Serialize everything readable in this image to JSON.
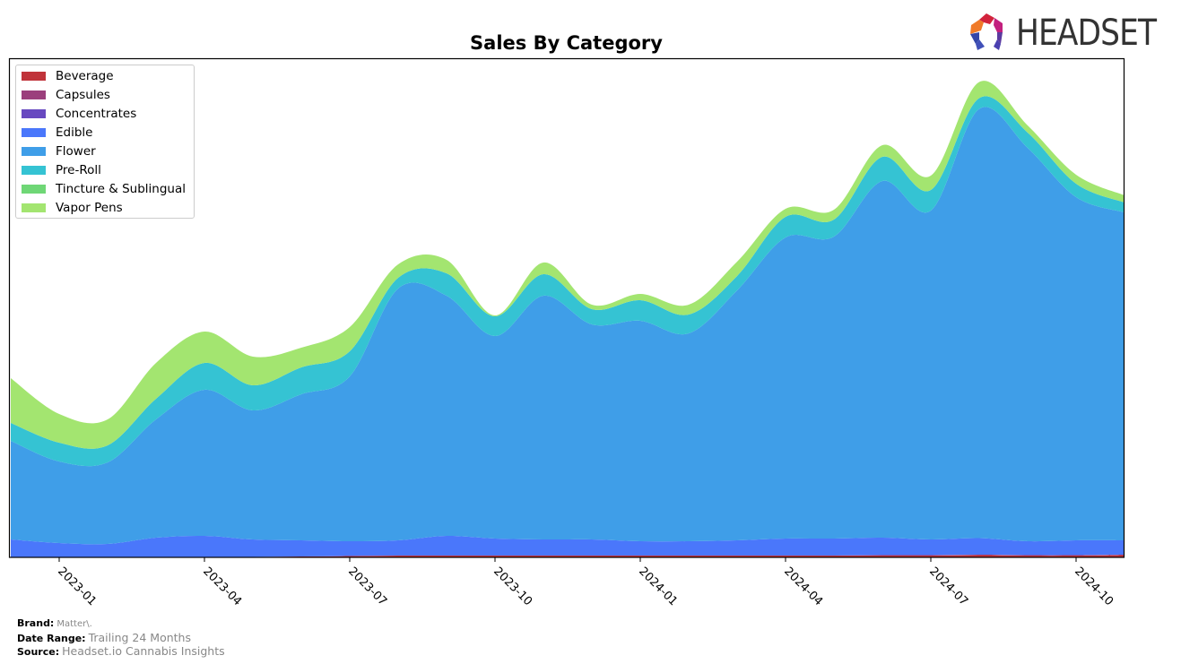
{
  "header": {
    "title": "Sales By Category",
    "logo_text": "HEADSET"
  },
  "footer": {
    "brand_label": "Brand:",
    "brand_value": "Matter\\.",
    "date_range_label": "Date Range:",
    "date_range_value": "Trailing 24 Months",
    "source_label": "Source:",
    "source_value": "Headset.io Cannabis Insights"
  },
  "chart_data": {
    "type": "area",
    "stacked": true,
    "smooth": true,
    "title": "Sales By Category",
    "xlabel": "",
    "ylabel": "",
    "y_units": "relative sales (unlabeled axis)",
    "grid": false,
    "legend_position": "top-left",
    "x": [
      "2022-12",
      "2023-01",
      "2023-02",
      "2023-03",
      "2023-04",
      "2023-05",
      "2023-06",
      "2023-07",
      "2023-08",
      "2023-09",
      "2023-10",
      "2023-11",
      "2023-12",
      "2024-01",
      "2024-02",
      "2024-03",
      "2024-04",
      "2024-05",
      "2024-06",
      "2024-07",
      "2024-08",
      "2024-09",
      "2024-10",
      "2024-11"
    ],
    "x_tick_labels": [
      "2023-01",
      "2023-04",
      "2023-07",
      "2023-10",
      "2024-01",
      "2024-04",
      "2024-07",
      "2024-10"
    ],
    "ylim": [
      0,
      556
    ],
    "series": [
      {
        "name": "Beverage",
        "color": "#c0333a",
        "values": [
          0,
          0,
          0,
          0,
          0,
          0.5,
          1,
          1.5,
          2,
          2,
          2,
          2,
          2,
          2,
          2,
          2,
          2,
          2,
          2,
          2,
          2.5,
          2,
          2,
          2.5
        ]
      },
      {
        "name": "Capsules",
        "color": "#9b3f7c",
        "values": [
          0,
          0,
          0,
          0,
          0,
          0,
          0,
          0,
          0,
          0,
          0,
          0,
          0,
          0,
          0,
          0,
          0,
          0,
          0.5,
          0.5,
          0.5,
          0.5,
          0.5,
          0.5
        ]
      },
      {
        "name": "Concentrates",
        "color": "#6849c0",
        "values": [
          0,
          0,
          0,
          0,
          0,
          0,
          0,
          0,
          0,
          0,
          0,
          0,
          0,
          0,
          0,
          0,
          0,
          0,
          0,
          0,
          0,
          0,
          0,
          0
        ]
      },
      {
        "name": "Edible",
        "color": "#4a77fb",
        "values": [
          20,
          16,
          15,
          22,
          24,
          19.5,
          18,
          16.5,
          17,
          22,
          19,
          18,
          18,
          16,
          16,
          17,
          19,
          19,
          19.5,
          17.5,
          18.5,
          15.5,
          16.5,
          16
        ]
      },
      {
        "name": "Flower",
        "color": "#3f9ee8",
        "values": [
          110,
          91,
          91,
          132,
          163,
          144,
          163,
          184,
          281,
          268,
          226,
          272,
          240,
          246,
          232,
          279,
          336,
          337,
          398,
          367,
          479,
          439,
          383,
          366
        ]
      },
      {
        "name": "Pre-Roll",
        "color": "#35c3d3",
        "values": [
          20,
          21,
          19,
          23,
          30,
          28,
          30,
          28,
          12,
          25,
          22,
          24,
          17,
          23,
          21,
          16,
          23,
          19,
          27,
          23,
          12,
          17,
          15,
          11
        ]
      },
      {
        "name": "Tincture & Sublingual",
        "color": "#6fd776",
        "values": [
          0,
          0,
          0,
          0,
          0,
          0,
          0,
          0,
          0,
          0,
          0,
          0,
          0,
          0,
          0,
          0,
          0,
          0,
          0,
          0,
          0,
          0,
          0,
          0
        ]
      },
      {
        "name": "Vapor Pens",
        "color": "#a3e570",
        "values": [
          50,
          32,
          29,
          40,
          35,
          32,
          22,
          27,
          15,
          15,
          1,
          13,
          5,
          7,
          11,
          16,
          9,
          11,
          13,
          16,
          18,
          8,
          10,
          8
        ]
      }
    ]
  }
}
